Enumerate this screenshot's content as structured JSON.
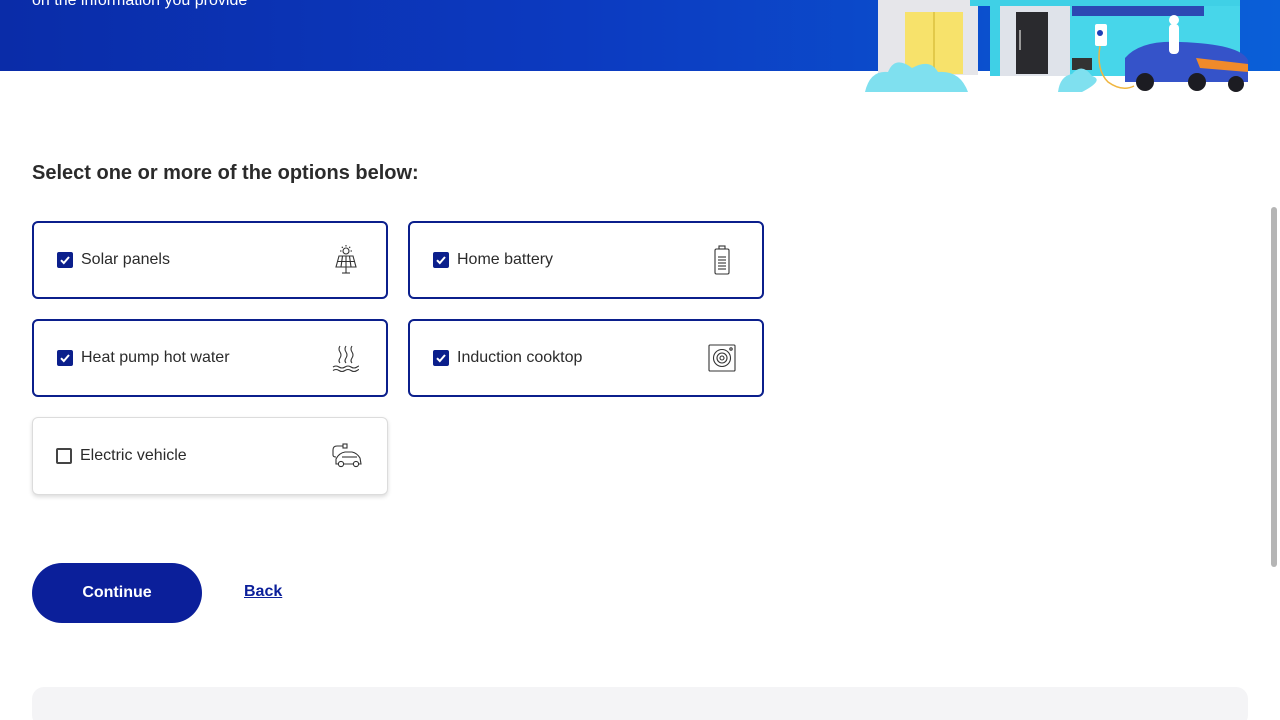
{
  "hero": {
    "subtitle": "on the information you provide"
  },
  "form": {
    "prompt": "Select one or more of the options below:",
    "options": [
      {
        "label": "Solar panels",
        "checked": true,
        "icon": "solar-panel-icon"
      },
      {
        "label": "Home battery",
        "checked": true,
        "icon": "battery-icon"
      },
      {
        "label": "Heat pump hot water",
        "checked": true,
        "icon": "heat-waves-icon"
      },
      {
        "label": "Induction cooktop",
        "checked": true,
        "icon": "cooktop-icon"
      },
      {
        "label": "Electric vehicle",
        "checked": false,
        "icon": "electric-car-icon"
      }
    ]
  },
  "actions": {
    "continue_label": "Continue",
    "back_label": "Back"
  },
  "colors": {
    "primary": "#0b1f9a",
    "hero_start": "#0a2ca8",
    "hero_end": "#0a5fd8"
  }
}
